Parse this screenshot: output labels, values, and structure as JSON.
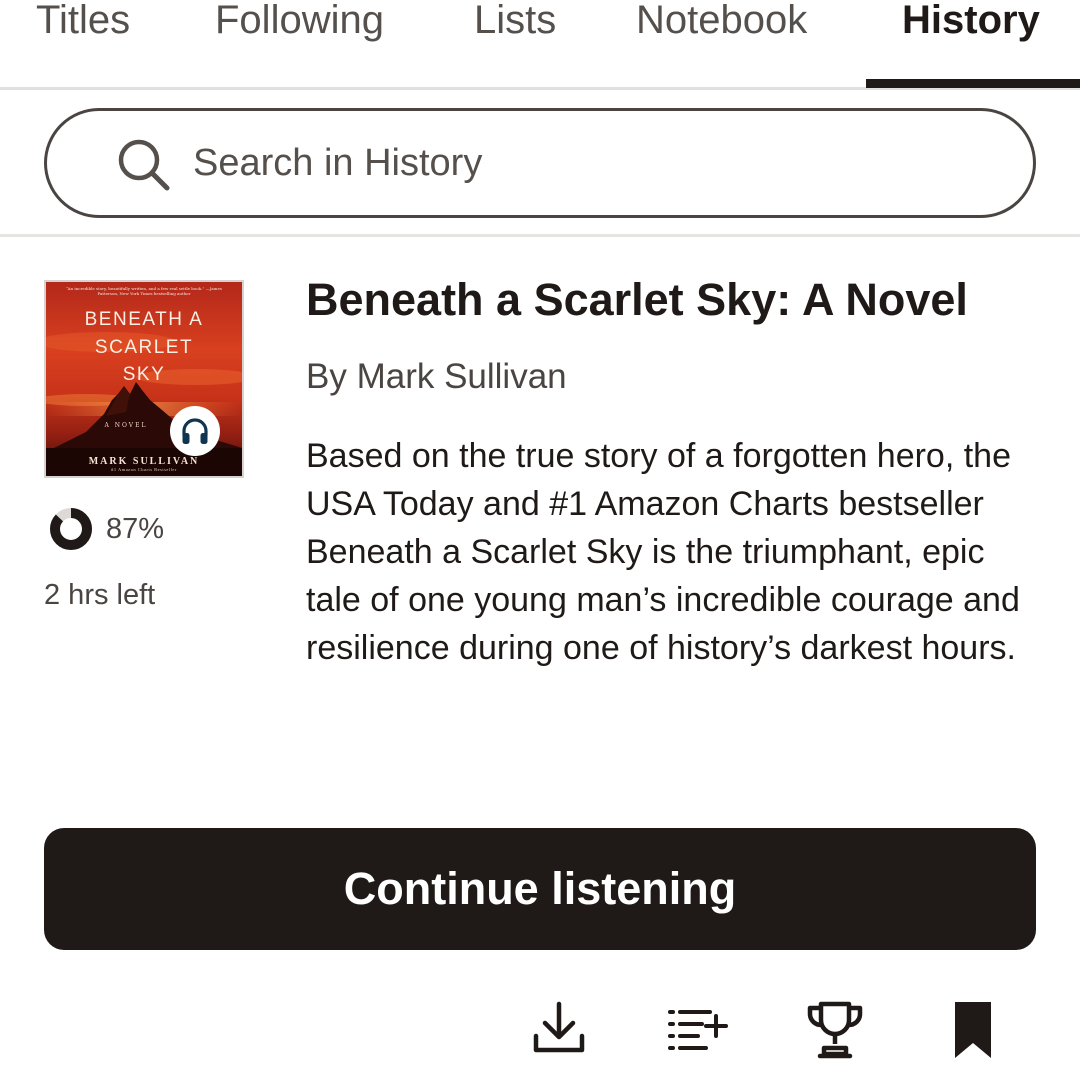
{
  "tabs": [
    {
      "label": "Titles",
      "active": false
    },
    {
      "label": "Following",
      "active": false
    },
    {
      "label": "Lists",
      "active": false
    },
    {
      "label": "Notebook",
      "active": false
    },
    {
      "label": "History",
      "active": true
    }
  ],
  "search": {
    "placeholder": "Search in History",
    "icon": "search-icon"
  },
  "book": {
    "title": "Beneath a Scarlet Sky: A Novel",
    "author": "By Mark Sullivan",
    "description": "Based on the true story of a forgotten hero, the USA Today and #1 Amazon Charts bestseller Beneath a Scarlet Sky is the triumphant, epic tale of one young man’s incredible courage and resilience during one of history’s darkest hours.",
    "format_icon": "headphones-icon",
    "cover": {
      "blurb": "“An incredible story, beautifully written, and a few real settle book.” —James Patterson, New York Times bestselling author",
      "title_lines": [
        "BENEATH A",
        "SCARLET",
        "SKY"
      ],
      "subtitle": "A NOVEL",
      "author": "MARK SULLIVAN",
      "tagline": "#1 Amazon Charts Bestseller"
    },
    "progress": {
      "percent": 87,
      "percent_label": "87%",
      "time_left": "2 hrs left"
    }
  },
  "primary_action": {
    "label": "Continue listening"
  },
  "actions": [
    {
      "name": "download",
      "icon": "download-icon"
    },
    {
      "name": "add-to-list",
      "icon": "add-to-list-icon"
    },
    {
      "name": "achievements",
      "icon": "trophy-icon"
    },
    {
      "name": "bookmark",
      "icon": "bookmark-icon"
    }
  ],
  "colors": {
    "text": "#1f1a17",
    "muted": "#4a4542",
    "button": "#1f1a17",
    "cover_red": "#c8321e"
  }
}
